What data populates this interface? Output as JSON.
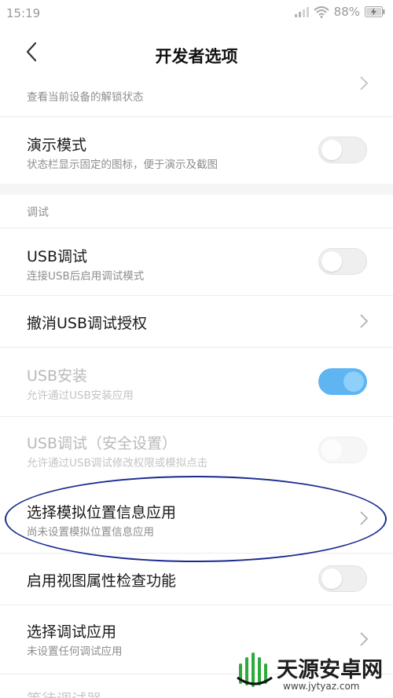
{
  "status_bar": {
    "time": "15:19",
    "battery": "88%"
  },
  "header": {
    "title": "开发者选项",
    "back_icon": "chevron-left-icon"
  },
  "rows": {
    "unlock_status": {
      "subtitle": "查看当前设备的解锁状态"
    },
    "demo_mode": {
      "title": "演示模式",
      "subtitle": "状态栏显示固定的图标，便于演示及截图",
      "toggle": "off"
    },
    "debug_section": {
      "label": "调试"
    },
    "usb_debug": {
      "title": "USB调试",
      "subtitle": "连接USB后启用调试模式",
      "toggle": "off"
    },
    "revoke_usb": {
      "title": "撤消USB调试授权"
    },
    "usb_install": {
      "title": "USB安装",
      "subtitle": "允许通过USB安装应用",
      "toggle": "on"
    },
    "usb_debug_secure": {
      "title": "USB调试（安全设置）",
      "subtitle": "允许通过USB调试修改权限或模拟点击",
      "toggle": "off"
    },
    "mock_location": {
      "title": "选择模拟位置信息应用",
      "subtitle": "尚未设置模拟位置信息应用"
    },
    "view_attr": {
      "title": "启用视图属性检查功能",
      "toggle": "off"
    },
    "select_debug_app": {
      "title": "选择调试应用",
      "subtitle": "未设置任何调试应用"
    },
    "wait_debugger": {
      "title": "等待调试器"
    }
  },
  "watermark": {
    "title": "天源安卓网",
    "url": "www.jytyaz.com"
  },
  "colors": {
    "accent": "#5fb4f2",
    "annotation": "#1a2b8f",
    "watermark_green": "#2eaa3a"
  }
}
